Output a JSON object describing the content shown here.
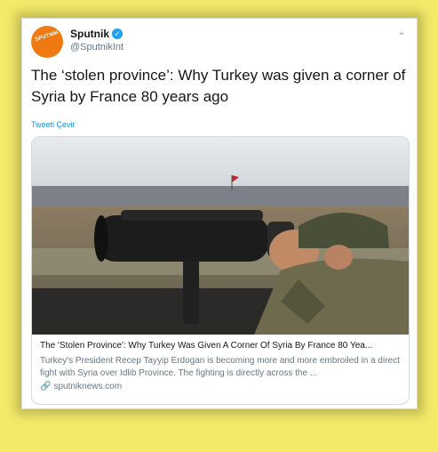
{
  "account": {
    "name": "Sputnik",
    "handle": "@SputnikInt",
    "avatar_text": "SPUTNIK",
    "verified_icon": "verified-badge-icon",
    "brand_color": "#f07a12"
  },
  "tweet": {
    "text": "The ‘stolen province’: Why Turkey was given a corner of Syria by France 80 years ago",
    "translate_label": "Tweeti Çevir"
  },
  "link_card": {
    "title": "The 'Stolen Province': Why Turkey Was Given A Corner Of Syria By France 80 Yea...",
    "description": "Turkey's President Recep Tayyip Erdogan is becoming more and more embroiled in a direct fight with Syria over Idlib Province. The fighting is directly across the ...",
    "domain": "sputniknews.com",
    "image_alt": "Soldier looking through large binoculars at border with flag in distance"
  },
  "colors": {
    "background": "#f3ea6a",
    "link_blue": "#1b95e0",
    "text": "#14171a",
    "muted": "#657786"
  }
}
